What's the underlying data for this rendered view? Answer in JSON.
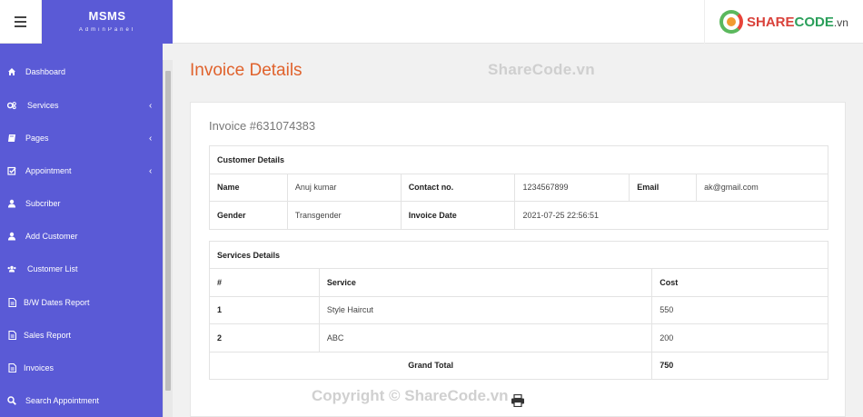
{
  "brand": {
    "title": "MSMS",
    "subtitle": "AdminPanel"
  },
  "logo": {
    "part1": "SHARE",
    "part2": "CODE",
    "part3": ".vn"
  },
  "sidebar": {
    "items": [
      {
        "label": "Dashboard",
        "icon": "home-icon",
        "caret": ""
      },
      {
        "label": "Services",
        "icon": "gears-icon",
        "caret": "‹"
      },
      {
        "label": "Pages",
        "icon": "book-icon",
        "caret": "‹"
      },
      {
        "label": "Appointment",
        "icon": "check-square-icon",
        "caret": "‹"
      },
      {
        "label": "Subcriber",
        "icon": "user-icon",
        "caret": ""
      },
      {
        "label": "Add Customer",
        "icon": "user-icon",
        "caret": ""
      },
      {
        "label": "Customer List",
        "icon": "users-icon",
        "caret": ""
      },
      {
        "label": "B/W Dates Report",
        "icon": "file-icon",
        "caret": ""
      },
      {
        "label": "Sales Report",
        "icon": "file-icon",
        "caret": ""
      },
      {
        "label": "Invoices",
        "icon": "file-icon",
        "caret": ""
      },
      {
        "label": "Search Appointment",
        "icon": "search-icon",
        "caret": ""
      }
    ]
  },
  "page": {
    "title": "Invoice Details",
    "watermark": "ShareCode.vn"
  },
  "invoice": {
    "title": "Invoice #631074383",
    "customer_heading": "Customer Details",
    "name_label": "Name",
    "name_value": "Anuj kumar",
    "contact_label": "Contact no.",
    "contact_value": "1234567899",
    "email_label": "Email",
    "email_value": "ak@gmail.com",
    "gender_label": "Gender",
    "gender_value": "Transgender",
    "date_label": "Invoice Date",
    "date_value": "2021-07-25 22:56:51",
    "services_heading": "Services Details",
    "col_num": "#",
    "col_service": "Service",
    "col_cost": "Cost",
    "rows": [
      {
        "num": "1",
        "service": "Style Haircut",
        "cost": "550"
      },
      {
        "num": "2",
        "service": "ABC",
        "cost": "200"
      }
    ],
    "grand_total_label": "Grand Total",
    "grand_total_value": "750"
  },
  "footer": {
    "copyright": "Copyright © ShareCode.vn"
  }
}
